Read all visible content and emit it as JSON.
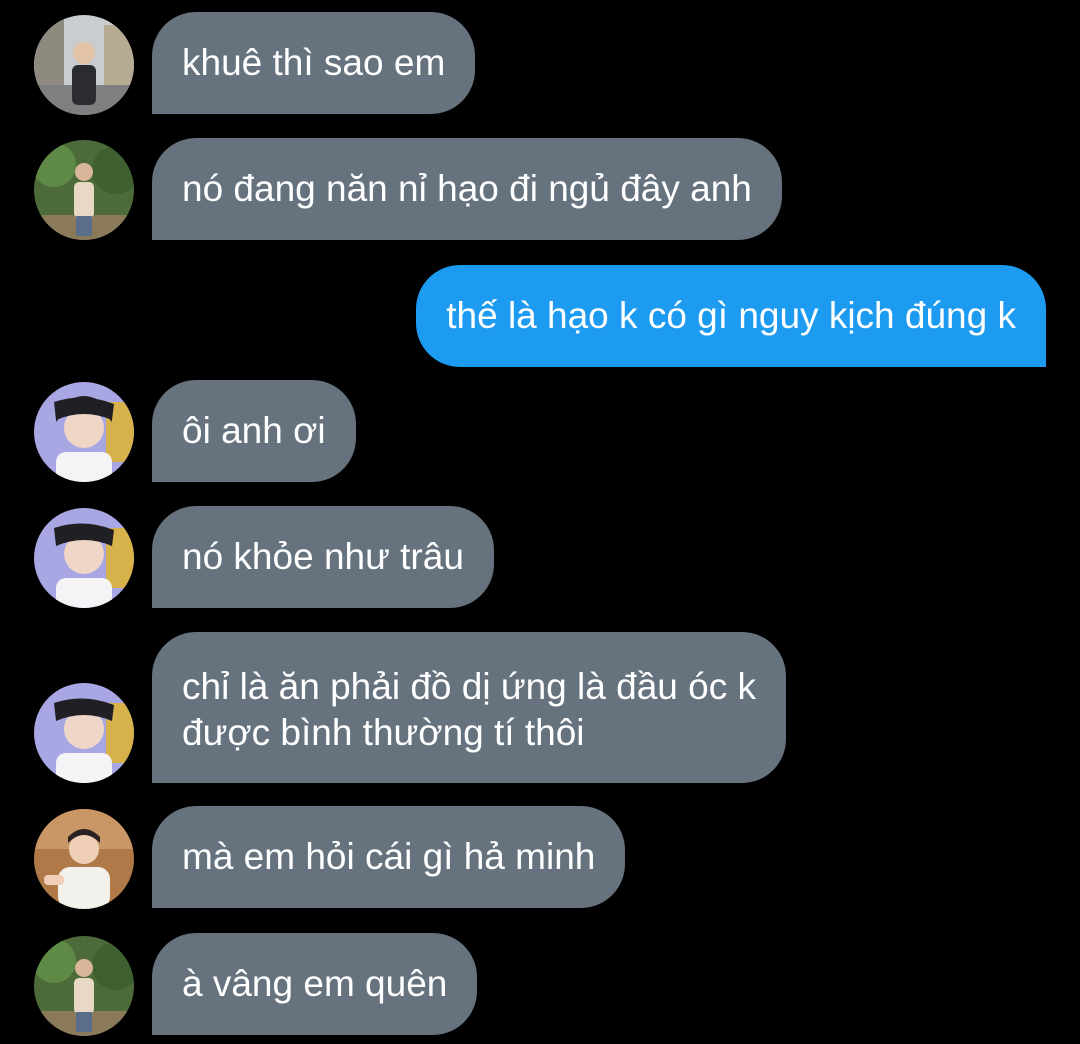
{
  "conversation": {
    "messages": [
      {
        "sender": "in",
        "avatar": "avatar-street",
        "text": "khuê thì sao em"
      },
      {
        "sender": "in",
        "avatar": "avatar-park",
        "text": "nó đang năn nỉ hạo đi ngủ đây anh"
      },
      {
        "sender": "out",
        "text": "thế là hạo k có gì nguy kịch đúng k"
      },
      {
        "sender": "in",
        "avatar": "avatar-smile",
        "text": "ôi anh ơi"
      },
      {
        "sender": "in",
        "avatar": "avatar-smile",
        "text": "nó khỏe như trâu"
      },
      {
        "sender": "in",
        "avatar": "avatar-smile",
        "text_lines": [
          "chỉ là ăn phải đồ dị ứng là đầu óc k",
          "được bình thường tí thôi"
        ]
      },
      {
        "sender": "in",
        "avatar": "avatar-room",
        "text": "mà em hỏi cái gì hả minh"
      },
      {
        "sender": "in",
        "avatar": "avatar-park",
        "text": "à vâng em quên"
      }
    ]
  },
  "colors": {
    "background": "#000000",
    "incoming_bubble": "#66737f",
    "outgoing_bubble": "#1d9bf0",
    "text": "#ffffff"
  }
}
